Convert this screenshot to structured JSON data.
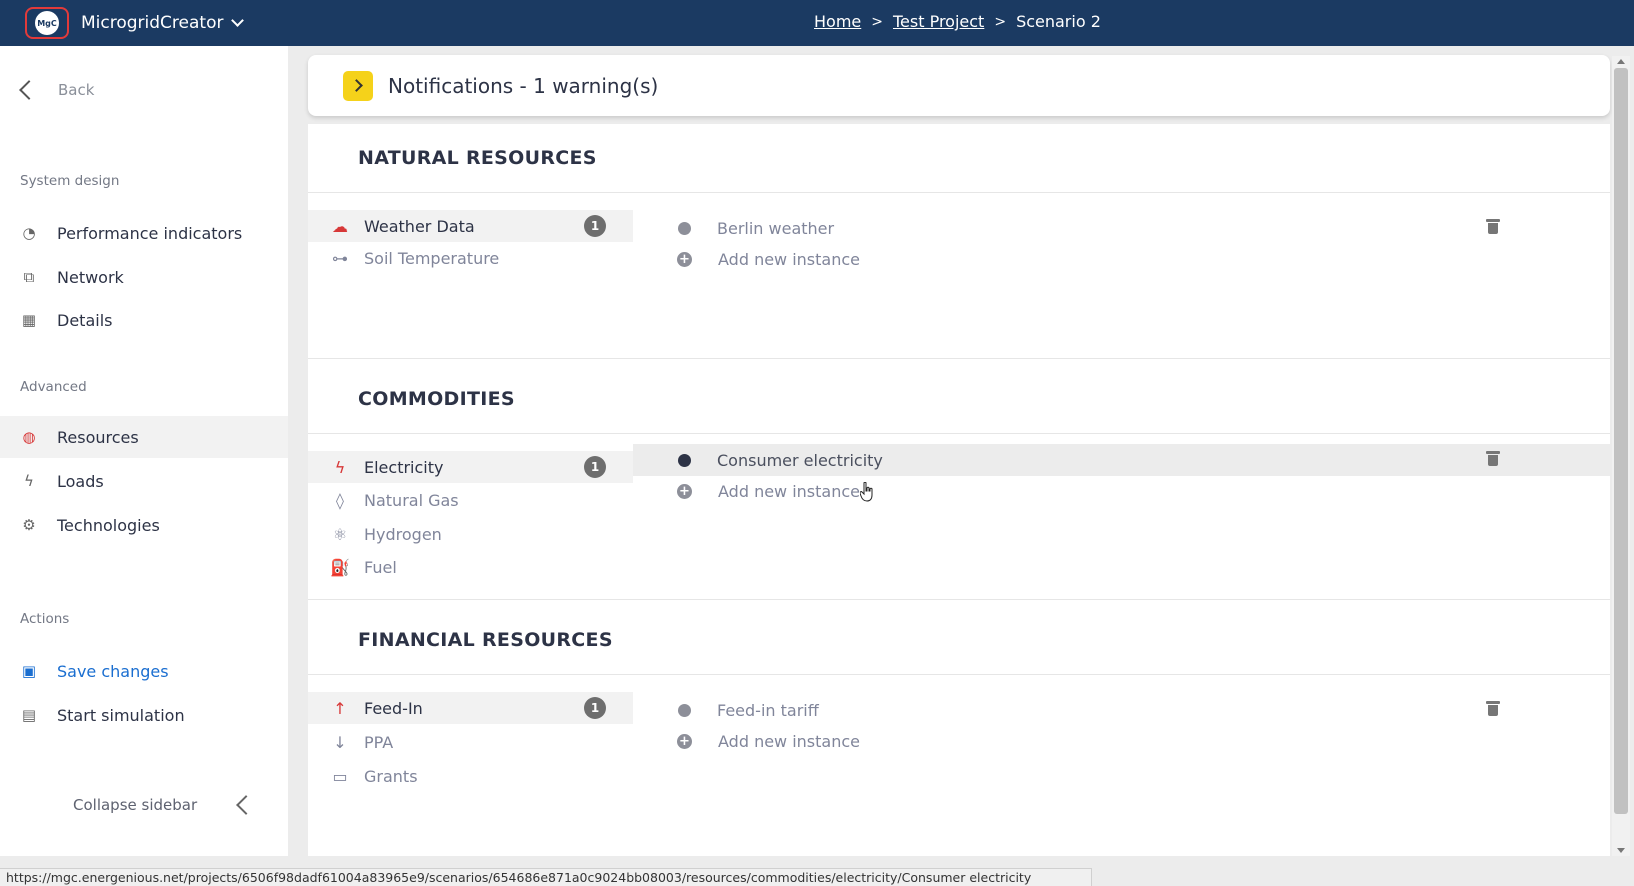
{
  "app": {
    "name": "MicrogridCreator",
    "logo_text": "MgC"
  },
  "breadcrumb": {
    "home": "Home",
    "project": "Test Project",
    "scenario": "Scenario 2",
    "separator": ">"
  },
  "sidebar": {
    "back_label": "Back",
    "sections": {
      "system_design": "System design",
      "advanced": "Advanced",
      "actions": "Actions"
    },
    "items": {
      "performance_indicators": "Performance indicators",
      "network": "Network",
      "details": "Details",
      "resources": "Resources",
      "loads": "Loads",
      "technologies": "Technologies",
      "save_changes": "Save changes",
      "start_simulation": "Start simulation"
    },
    "collapse_label": "Collapse sidebar",
    "active_item": "Resources"
  },
  "notifications": {
    "text": "Notifications - 1 warning(s)"
  },
  "categories": {
    "natural": {
      "title": "NATURAL RESOURCES",
      "items": [
        {
          "label": "Weather Data",
          "icon": "cloud-sun-rain-icon",
          "count": "1"
        },
        {
          "label": "Soil Temperature",
          "icon": "sitemap-icon"
        }
      ],
      "instances": [
        "Berlin weather"
      ],
      "add_label": "Add new instance"
    },
    "commodities": {
      "title": "COMMODITIES",
      "items": [
        {
          "label": "Electricity",
          "icon": "bolt-icon",
          "count": "1"
        },
        {
          "label": "Natural Gas",
          "icon": "droplet-icon"
        },
        {
          "label": "Hydrogen",
          "icon": "atom-icon"
        },
        {
          "label": "Fuel",
          "icon": "oil-can-icon"
        }
      ],
      "instances": [
        "Consumer electricity"
      ],
      "add_label": "Add new instance"
    },
    "financial": {
      "title": "FINANCIAL RESOURCES",
      "items": [
        {
          "label": "Feed-In",
          "icon": "arrow-up-icon",
          "count": "1"
        },
        {
          "label": "PPA",
          "icon": "arrow-down-icon"
        },
        {
          "label": "Grants",
          "icon": "money-bill-icon"
        }
      ],
      "instances": [
        "Feed-in tariff"
      ],
      "add_label": "Add new instance"
    }
  },
  "colors": {
    "topbar": "#1b3a62",
    "accent_red": "#d73838",
    "link_blue": "#1a6ed0",
    "warning_yellow": "#f5d21a"
  },
  "status_url": "https://mgc.energenious.net/projects/6506f98dadf61004a83965e9/scenarios/654686e871a0c9024bb08003/resources/commodities/electricity/Consumer electricity"
}
